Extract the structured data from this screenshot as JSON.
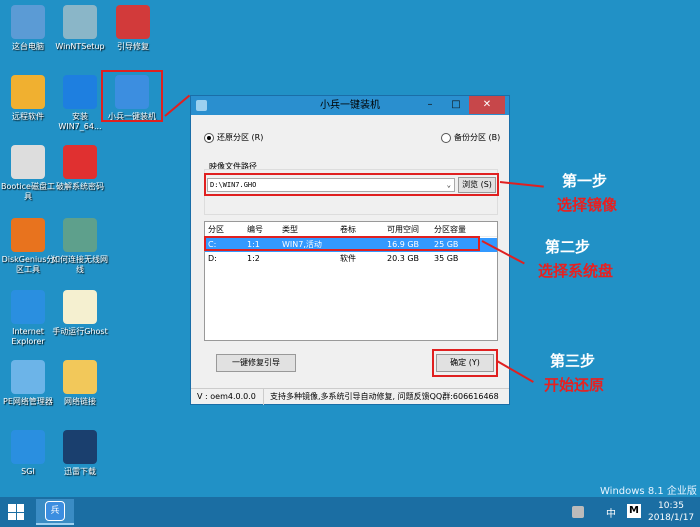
{
  "desktop": {
    "icons": [
      {
        "label": "这台电脑",
        "icon": "computer-icon",
        "color": "#5b9bd5"
      },
      {
        "label": "WinNTSetup",
        "icon": "setup-icon",
        "color": "#8ab6c8"
      },
      {
        "label": "引导修复",
        "icon": "repair-kit-icon",
        "color": "#d23a3a"
      },
      {
        "label": "远程软件",
        "icon": "remote-icon",
        "color": "#f0b030"
      },
      {
        "label": "安装 WIN7_64...",
        "icon": "install-gear-icon",
        "color": "#1e7fe0"
      },
      {
        "label": "小兵一键装机",
        "icon": "xiaobing-icon",
        "color": "#3c8ee0"
      },
      {
        "label": "Bootice磁盘工具",
        "icon": "floppy-icon",
        "color": "#ddd"
      },
      {
        "label": "破解系统密码",
        "icon": "nt-key-icon",
        "color": "#e03030"
      },
      {
        "label": "DiskGenius分区工具",
        "icon": "diskgenius-icon",
        "color": "#e8731e"
      },
      {
        "label": "如何连接无线网线",
        "icon": "landscape-image-icon",
        "color": "#5ea08c"
      },
      {
        "label": "Internet Explorer",
        "icon": "ie-icon",
        "color": "#2a8fe0"
      },
      {
        "label": "手动运行Ghost",
        "icon": "ghost-icon",
        "color": "#f5f0d0"
      },
      {
        "label": "PE网络管理器",
        "icon": "network-icon",
        "color": "#6cb4e8"
      },
      {
        "label": "网络链接",
        "icon": "folder-icon",
        "color": "#f2c85a"
      },
      {
        "label": "SGI",
        "icon": "sgi-icon",
        "color": "#2a8fe0"
      },
      {
        "label": "迅雷下载",
        "icon": "thunder-icon",
        "color": "#1a3f6e"
      }
    ]
  },
  "dialog": {
    "title": "小兵一键装机",
    "radio_restore": "还原分区 (R)",
    "radio_backup": "备份分区 (B)",
    "restore_selected": true,
    "path_label": "映像文件路径",
    "path_value": "D:\\WIN7.GHO",
    "browse": "浏览 (S)",
    "columns": [
      "分区",
      "编号",
      "类型",
      "卷标",
      "可用空间",
      "分区容量"
    ],
    "rows": [
      [
        "C:",
        "1:1",
        "WIN7,活动",
        "",
        "16.9 GB",
        "25 GB"
      ],
      [
        "D:",
        "1:2",
        "",
        "软件",
        "20.3 GB",
        "35 GB"
      ]
    ],
    "repair_boot": "一键修复引导",
    "ok": "确定 (Y)",
    "version": "V : oem4.0.0.0",
    "status_text": "支持多种镜像,多系统引导自动修复, 问题反馈QQ群:606616468"
  },
  "annotations": {
    "step1": "第一步",
    "step1_desc": "选择镜像",
    "step2": "第二步",
    "step2_desc": "选择系统盘",
    "step3": "第三步",
    "step3_desc": "开始还原",
    "accent": "#e82020"
  },
  "watermark": "Windows 8.1 企业版",
  "taskbar": {
    "ime": "中",
    "time": "10:35",
    "date": "2018/1/17"
  }
}
